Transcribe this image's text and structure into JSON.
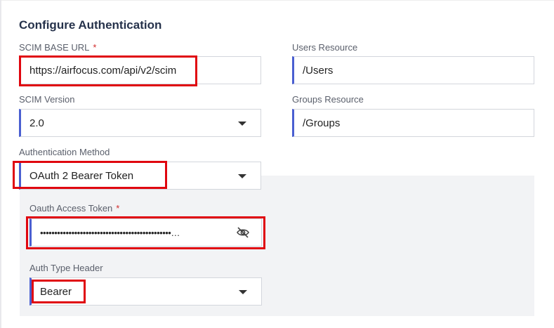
{
  "form": {
    "title": "Configure Authentication",
    "scim_base_url": {
      "label": "SCIM BASE URL",
      "required_mark": "*",
      "value": "https://airfocus.com/api/v2/scim"
    },
    "users_resource": {
      "label": "Users Resource",
      "value": "/Users"
    },
    "scim_version": {
      "label": "SCIM Version",
      "value": "2.0"
    },
    "groups_resource": {
      "label": "Groups Resource",
      "value": "/Groups"
    },
    "auth_method": {
      "label": "Authentication Method",
      "value": "OAuth 2 Bearer Token"
    },
    "oauth_token": {
      "label": "Oauth Access Token",
      "required_mark": "*",
      "value": "••••••••••••••••••••••••••••••••••••••••••••••…",
      "toggle_icon": "eye-off-icon"
    },
    "auth_type_header": {
      "label": "Auth Type Header",
      "value": "Bearer"
    }
  },
  "colors": {
    "accent": "#4a5fd1",
    "highlight": "#e0060f",
    "panel": "#f2f3f5"
  }
}
